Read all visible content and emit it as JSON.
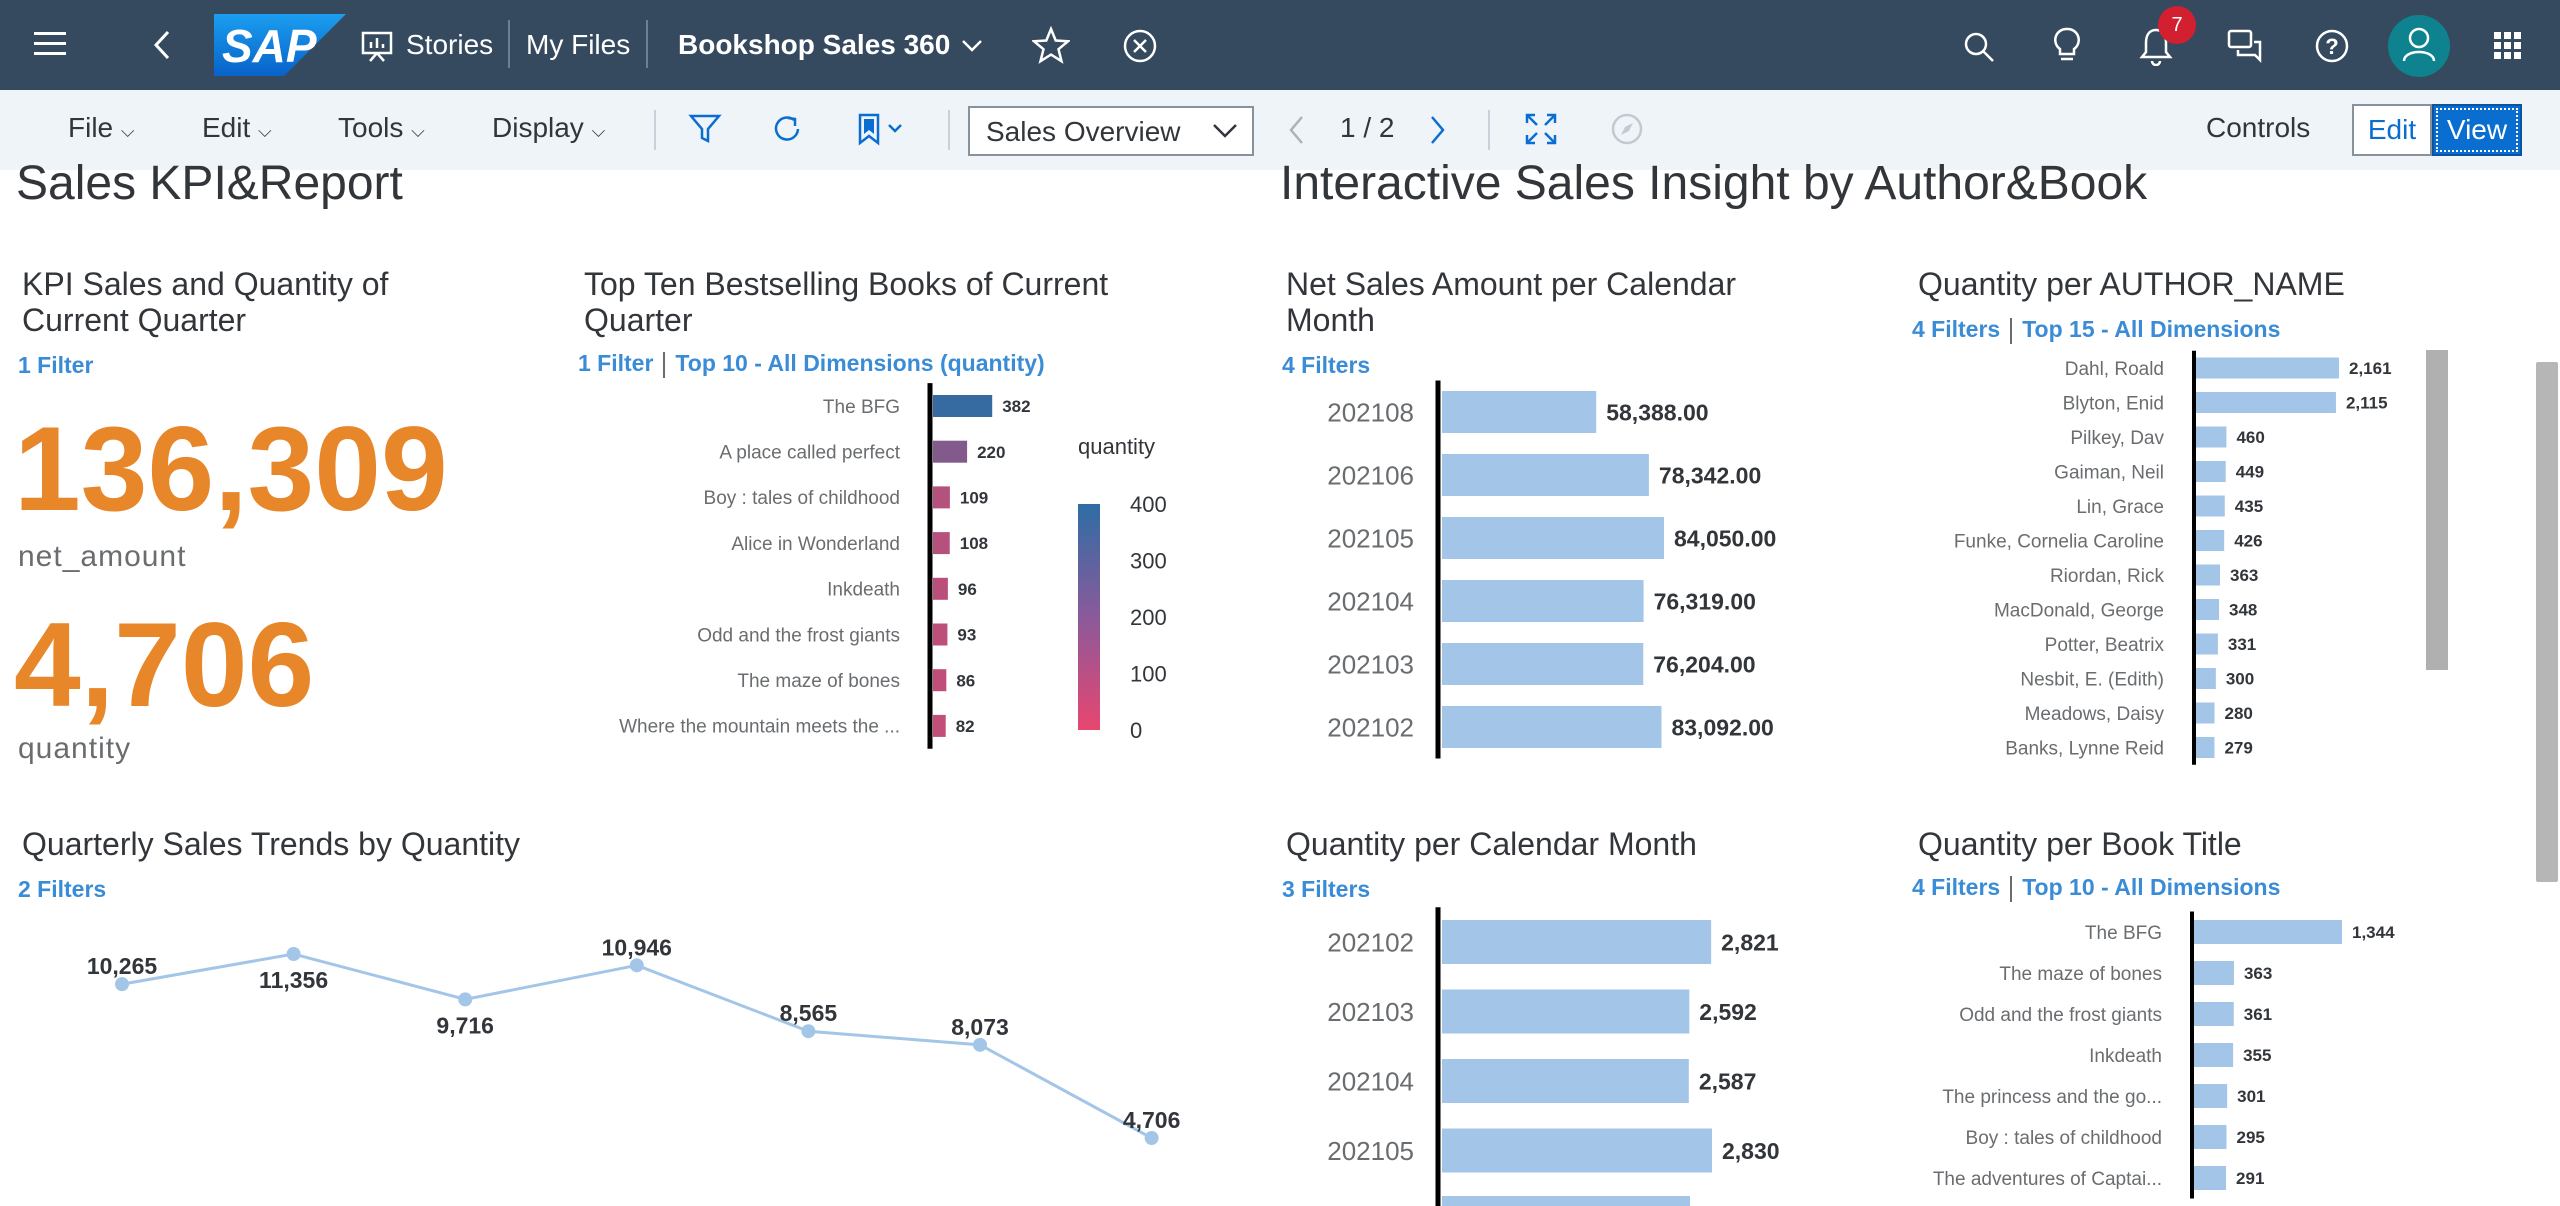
{
  "shell": {
    "logo_text": "SAP",
    "stories": "Stories",
    "my_files": "My Files",
    "story_title": "Bookshop Sales 360",
    "notifications_count": "7",
    "icons": [
      "menu-icon",
      "back-icon",
      "stories-icon",
      "chevron-down-icon",
      "star-icon",
      "close-circle-icon",
      "search-icon",
      "lightbulb-icon",
      "bell-icon",
      "chat-icon",
      "help-icon",
      "user-icon",
      "grid-icon"
    ]
  },
  "toolbar": {
    "file": "File",
    "edit_menu": "Edit",
    "tools": "Tools",
    "display": "Display",
    "page_select": "Sales Overview",
    "page_indicator": "1 / 2",
    "controls": "Controls",
    "edit_button": "Edit",
    "view_button": "View"
  },
  "sections": {
    "left_title": "Sales KPI&Report",
    "right_title": "Interactive Sales Insight by Author&Book"
  },
  "kpi": {
    "title_line1": "KPI Sales and Quantity of",
    "title_line2": "Current Quarter",
    "filters": "1 Filter",
    "net_amount_value": "136,309",
    "net_amount_label": "net_amount",
    "quantity_value": "4,706",
    "quantity_label": "quantity",
    "accent_color": "#e8862a"
  },
  "top_ten": {
    "title_line1": "Top Ten Bestselling Books of Current",
    "title_line2": "Quarter",
    "filters": "1 Filter",
    "ranking": "Top 10 - All Dimensions (quantity)"
  },
  "net_sales_month": {
    "title_line1": "Net Sales Amount per Calendar",
    "title_line2": "Month",
    "filters": "4 Filters"
  },
  "qty_author": {
    "title": "Quantity per AUTHOR_NAME",
    "filters": "4 Filters",
    "ranking": "Top 15 - All Dimensions"
  },
  "quarterly": {
    "title": "Quarterly Sales Trends by Quantity",
    "filters": "2 Filters"
  },
  "qty_month": {
    "title": "Quantity per Calendar Month",
    "filters": "3 Filters"
  },
  "qty_book": {
    "title": "Quantity per Book Title",
    "filters": "4 Filters",
    "ranking": "Top 10 - All Dimensions"
  },
  "chart_data": [
    {
      "id": "top_ten",
      "type": "bar",
      "orientation": "horizontal",
      "categories": [
        "The BFG",
        "A place called perfect",
        "Boy : tales of childhood",
        "Alice in Wonderland",
        "Inkdeath",
        "Odd and the frost giants",
        "The maze of bones",
        "Where the mountain meets the ..."
      ],
      "values": [
        382,
        220,
        109,
        108,
        96,
        93,
        86,
        82
      ],
      "labels": [
        "382",
        "220",
        "109",
        "108",
        "96",
        "93",
        "86",
        "82"
      ],
      "legend": {
        "title": "quantity",
        "ticks": [
          "400",
          "300",
          "200",
          "100",
          "0"
        ],
        "range": [
          0,
          400
        ],
        "colors": [
          "#e8466f",
          "#2e6da4"
        ]
      },
      "xlim": [
        0,
        400
      ]
    },
    {
      "id": "net_sales_month",
      "type": "bar",
      "orientation": "horizontal",
      "categories": [
        "202108",
        "202106",
        "202105",
        "202104",
        "202103",
        "202102"
      ],
      "values": [
        58388,
        78342,
        84050,
        76319,
        76204,
        83092
      ],
      "labels": [
        "58,388.00",
        "78,342.00",
        "84,050.00",
        "76,319.00",
        "76,204.00",
        "83,092.00"
      ],
      "xlim": [
        0,
        84050
      ],
      "color": "#a3c6e8"
    },
    {
      "id": "qty_author",
      "type": "bar",
      "orientation": "horizontal",
      "categories": [
        "Dahl, Roald",
        "Blyton, Enid",
        "Pilkey, Dav",
        "Gaiman, Neil",
        "Lin, Grace",
        "Funke, Cornelia Caroline",
        "Riordan, Rick",
        "MacDonald, George",
        "Potter, Beatrix",
        "Nesbit, E. (Edith)",
        "Meadows, Daisy",
        "Banks, Lynne Reid"
      ],
      "values": [
        2161,
        2115,
        460,
        449,
        435,
        426,
        363,
        348,
        331,
        300,
        280,
        279
      ],
      "labels": [
        "2,161",
        "2,115",
        "460",
        "449",
        "435",
        "426",
        "363",
        "348",
        "331",
        "300",
        "280",
        "279"
      ],
      "xlim": [
        0,
        2161
      ],
      "color": "#a3c6e8"
    },
    {
      "id": "quarterly",
      "type": "line",
      "values": [
        10265,
        11356,
        9716,
        10946,
        8565,
        8073,
        4706
      ],
      "labels": [
        "10,265",
        "11,356",
        "9,716",
        "10,946",
        "8,565",
        "8,073",
        "4,706"
      ],
      "ylim": [
        4706,
        11356
      ],
      "color": "#a3c6e8"
    },
    {
      "id": "qty_month",
      "type": "bar",
      "orientation": "horizontal",
      "categories": [
        "202102",
        "202103",
        "202104",
        "202105"
      ],
      "values": [
        2821,
        2592,
        2587,
        2830
      ],
      "labels": [
        "2,821",
        "2,592",
        "2,587",
        "2,830"
      ],
      "xlim": [
        0,
        2830
      ],
      "color": "#a3c6e8"
    },
    {
      "id": "qty_book",
      "type": "bar",
      "orientation": "horizontal",
      "categories": [
        "The BFG",
        "The maze of bones",
        "Odd and the frost giants",
        "Inkdeath",
        "The princess and the go...",
        "Boy : tales of childhood",
        "The adventures of Captai..."
      ],
      "values": [
        1344,
        363,
        361,
        355,
        301,
        295,
        291
      ],
      "labels": [
        "1,344",
        "363",
        "361",
        "355",
        "301",
        "295",
        "291"
      ],
      "xlim": [
        0,
        1344
      ],
      "color": "#a3c6e8"
    }
  ]
}
